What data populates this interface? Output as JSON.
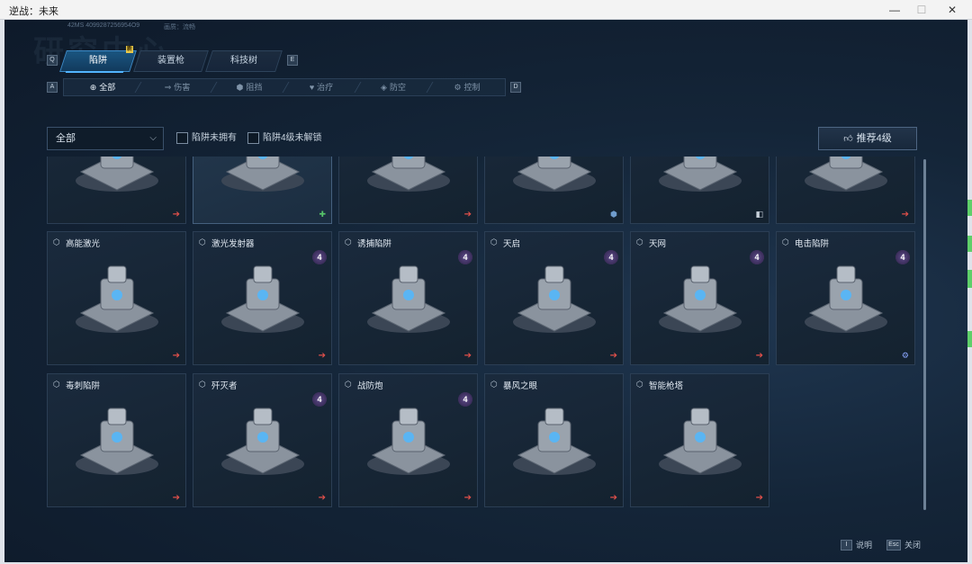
{
  "window": {
    "title": "逆战：未来",
    "minimize": "—",
    "maximize": "☐",
    "close": "✕"
  },
  "game": {
    "bg_title": "研究中心",
    "debug": {
      "left": "42MS  4099287256954O9",
      "right": "画质：流畅"
    },
    "tabs": [
      {
        "label": "陷阱",
        "key": "Q",
        "active": true,
        "new": true
      },
      {
        "label": "装置枪",
        "active": false
      },
      {
        "label": "科技树",
        "key": "E",
        "active": false
      }
    ],
    "tab_keys": {
      "left": "Q",
      "right": "E"
    },
    "new_badge": "新",
    "subtabs": [
      {
        "label": "全部",
        "icon": "⊕",
        "active": true
      },
      {
        "label": "伤害",
        "icon": "⇒",
        "active": false
      },
      {
        "label": "阻挡",
        "icon": "⬢",
        "active": false
      },
      {
        "label": "治疗",
        "icon": "♥",
        "active": false
      },
      {
        "label": "防空",
        "icon": "◈",
        "active": false
      },
      {
        "label": "控制",
        "icon": "⚙",
        "active": false
      }
    ],
    "subtab_keys": {
      "left": "A",
      "right": "D"
    },
    "filters": {
      "dropdown_value": "全部",
      "check_unowned": "陷阱未拥有",
      "check_lv4": "陷阱4级未解锁",
      "recommend": "推荐4级"
    },
    "top_row_cats": [
      "arrow",
      "heal",
      "arrow",
      "shield",
      "block",
      "arrow"
    ],
    "cards": [
      {
        "name": "高能激光",
        "lvl": "",
        "cat": "arrow"
      },
      {
        "name": "激光发射器",
        "lvl": "4",
        "cat": "arrow"
      },
      {
        "name": "诱捕陷阱",
        "lvl": "4",
        "cat": "arrow"
      },
      {
        "name": "天启",
        "lvl": "4",
        "cat": "arrow"
      },
      {
        "name": "天网",
        "lvl": "4",
        "cat": "arrow"
      },
      {
        "name": "电击陷阱",
        "lvl": "4",
        "cat": "gear"
      },
      {
        "name": "毒刺陷阱",
        "lvl": "",
        "cat": "arrow"
      },
      {
        "name": "歼灭者",
        "lvl": "4",
        "cat": "arrow"
      },
      {
        "name": "战防炮",
        "lvl": "4",
        "cat": "arrow"
      },
      {
        "name": "暴风之眼",
        "lvl": "",
        "cat": "arrow"
      },
      {
        "name": "智能枪塔",
        "lvl": "",
        "cat": "arrow"
      }
    ],
    "bottom": {
      "help_key": "I",
      "help": "说明",
      "close_key": "Esc",
      "close": "关闭"
    }
  },
  "colors": {
    "accent": "#52b4ff",
    "arrow": "#e0504a",
    "heal": "#56c46a",
    "gear": "#8aa6ff"
  }
}
